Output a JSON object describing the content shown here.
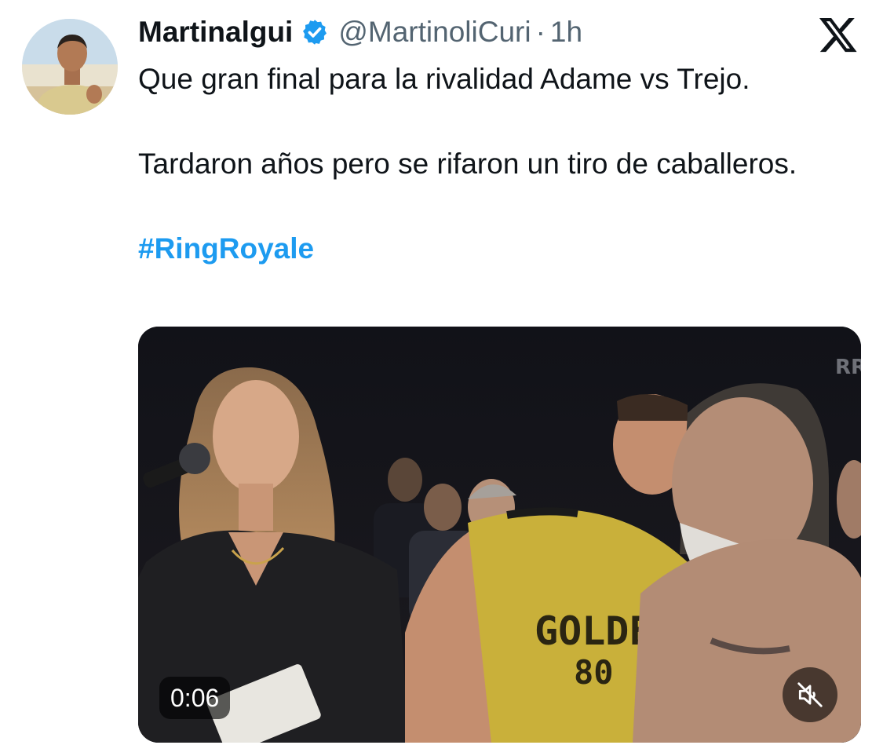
{
  "tweet": {
    "author_name": "Martinalgui",
    "author_handle": "@MartinoliCuri",
    "separator": "·",
    "time_ago": "1h",
    "text_line1": "Que gran final para la rivalidad Adame vs Trejo.",
    "text_line2": "Tardaron años pero se rifaron un tiro de caballeros.",
    "hashtag": "#RingRoyale"
  },
  "media": {
    "type": "video",
    "duration": "0:06",
    "muted": true,
    "shirt_text": "GOLDE",
    "shirt_number": "80",
    "watermark_text": "RR"
  },
  "icons": {
    "verified": "verified-badge-icon",
    "platform": "x-logo-icon",
    "mute": "speaker-muted-icon"
  },
  "colors": {
    "accent": "#1d9bf0",
    "text_primary": "#0f1419",
    "text_secondary": "#536471",
    "background": "#ffffff"
  }
}
